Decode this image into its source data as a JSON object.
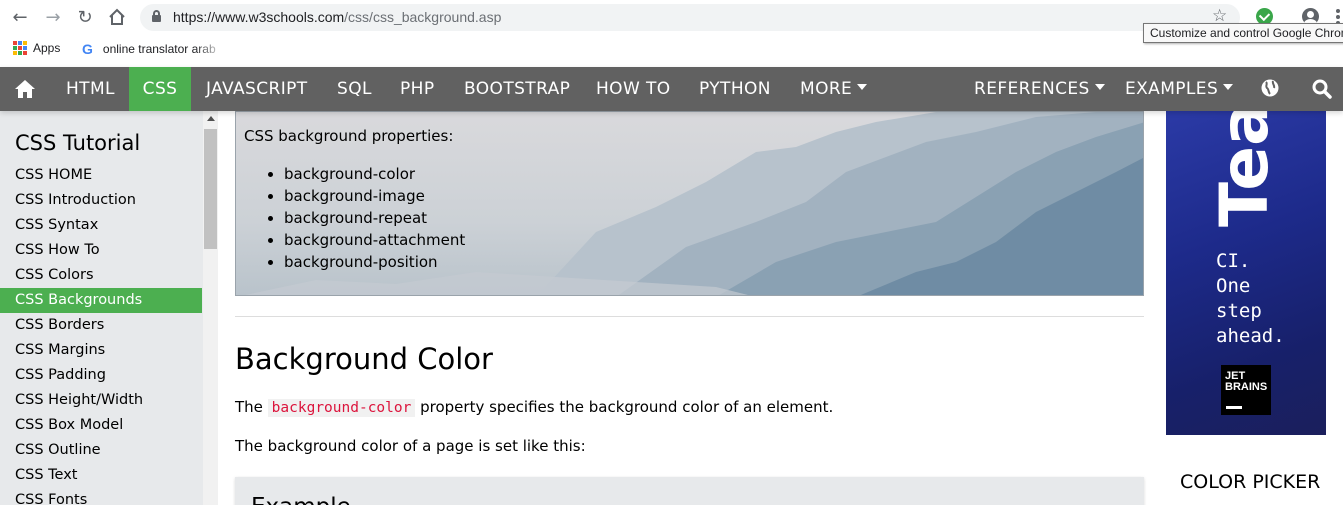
{
  "browser": {
    "url_host": "https://www.w3schools.com",
    "url_path": "/css/css_background.asp",
    "tooltip": "Customize and control Google Chrome",
    "bookmarks": [
      {
        "label": "Apps"
      },
      {
        "label": "online translator arab"
      }
    ]
  },
  "topnav": {
    "items": [
      {
        "label": "HTML"
      },
      {
        "label": "CSS"
      },
      {
        "label": "JAVASCRIPT"
      },
      {
        "label": "SQL"
      },
      {
        "label": "PHP"
      },
      {
        "label": "BOOTSTRAP"
      },
      {
        "label": "HOW TO"
      },
      {
        "label": "PYTHON"
      },
      {
        "label": "MORE"
      },
      {
        "label": "REFERENCES"
      },
      {
        "label": "EXAMPLES"
      }
    ],
    "active": "CSS",
    "accent_color": "#4CAF50",
    "bar_color": "#616161"
  },
  "sidebar": {
    "title": "CSS Tutorial",
    "items": [
      {
        "label": "CSS HOME"
      },
      {
        "label": "CSS Introduction"
      },
      {
        "label": "CSS Syntax"
      },
      {
        "label": "CSS How To"
      },
      {
        "label": "CSS Colors"
      },
      {
        "label": "CSS Backgrounds"
      },
      {
        "label": "CSS Borders"
      },
      {
        "label": "CSS Margins"
      },
      {
        "label": "CSS Padding"
      },
      {
        "label": "CSS Height/Width"
      },
      {
        "label": "CSS Box Model"
      },
      {
        "label": "CSS Outline"
      },
      {
        "label": "CSS Text"
      },
      {
        "label": "CSS Fonts"
      }
    ],
    "active": "CSS Backgrounds"
  },
  "main": {
    "demo_heading": "CSS background properties:",
    "demo_list": [
      "background-color",
      "background-image",
      "background-repeat",
      "background-attachment",
      "background-position"
    ],
    "section_title": "Background Color",
    "p1_before": "The ",
    "p1_code": "background-color",
    "p1_after": " property specifies the background color of an element.",
    "p2": "The background color of a page is set like this:",
    "example_title": "Example"
  },
  "ad": {
    "big_text": "Tea",
    "lines": [
      "CI.",
      "One",
      "step",
      "ahead."
    ],
    "logo_line1": "JET",
    "logo_line2": "BRAINS"
  },
  "right": {
    "color_picker": "COLOR PICKER"
  }
}
